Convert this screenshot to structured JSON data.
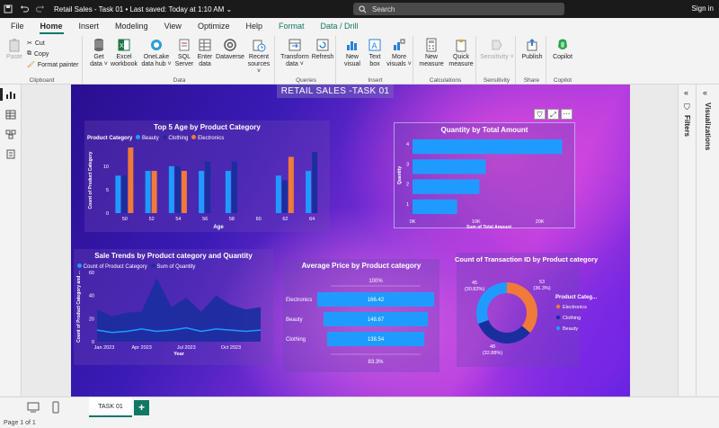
{
  "titlebar": {
    "title": "Retail Sales - Task 01",
    "saved": "Last saved: Today at 1:10 AM",
    "search_placeholder": "Search",
    "signin": "Sign in"
  },
  "menu": {
    "tabs": [
      "File",
      "Home",
      "Insert",
      "Modeling",
      "View",
      "Optimize",
      "Help",
      "Format",
      "Data / Drill"
    ]
  },
  "ribbon": {
    "clipboard": {
      "paste": "Paste",
      "cut": "Cut",
      "copy": "Copy",
      "format_painter": "Format painter",
      "label": "Clipboard"
    },
    "data": {
      "get_data": "Get data ˅",
      "excel": "Excel workbook",
      "onelake": "OneLake data hub ˅",
      "sql": "SQL Server",
      "enter": "Enter data",
      "dataverse": "Dataverse",
      "recent": "Recent sources ˅",
      "label": "Data"
    },
    "queries": {
      "transform": "Transform data ˅",
      "refresh": "Refresh",
      "label": "Queries"
    },
    "insert": {
      "new_visual": "New visual",
      "text_box": "Text box",
      "more_visuals": "More visuals ˅",
      "label": "Insert"
    },
    "calculations": {
      "new_measure": "New measure",
      "quick_measure": "Quick measure",
      "label": "Calculations"
    },
    "sensitivity": {
      "btn": "Sensitivity ˅",
      "label": "Sensitivity"
    },
    "share": {
      "publish": "Publish",
      "label": "Share"
    },
    "copilot": {
      "btn": "Copilot",
      "label": "Copilot"
    }
  },
  "report": {
    "title": "RETAIL SALES -TASK 01"
  },
  "panes": {
    "filters": "Filters",
    "visualizations": "Visualizations"
  },
  "pages": {
    "tab": "TASK 01",
    "add": "+"
  },
  "status": {
    "page": "Page 1 of 1"
  },
  "colors": {
    "beauty": "#1f9bff",
    "clothing": "#1a2e9e",
    "electronics": "#f07a3a",
    "accent": "#117865"
  },
  "chart_data": [
    {
      "type": "bar",
      "title": "Top 5 Age by Product Category",
      "legend_title": "Product Category",
      "xlabel": "Age",
      "ylabel": "Count of Product Category",
      "categories": [
        "50",
        "52",
        "54",
        "56",
        "58",
        "60",
        "62",
        "64"
      ],
      "ylim": [
        0,
        14
      ],
      "yticks": [
        "0",
        "5",
        "10"
      ],
      "series": [
        {
          "name": "Beauty",
          "values": [
            8,
            9,
            10,
            9,
            9,
            0,
            8,
            9
          ]
        },
        {
          "name": "Clothing",
          "values": [
            8,
            0,
            10,
            11,
            11,
            0,
            7,
            13
          ]
        },
        {
          "name": "Electronics",
          "values": [
            14,
            9,
            9,
            0,
            0,
            0,
            12,
            0
          ]
        }
      ],
      "extra": [
        {
          "cat_index": 0,
          "series": "Electronics"
        }
      ]
    },
    {
      "type": "bar",
      "orientation": "horizontal",
      "title": "Quantity by Total Amount",
      "xlabel": "Sum of Total Amount",
      "ylabel": "Quantity",
      "categories": [
        "4",
        "3",
        "2",
        "1"
      ],
      "values": [
        23500,
        11500,
        10500,
        7000
      ],
      "xlim": [
        0,
        24000
      ],
      "xticks": [
        "0K",
        "10K",
        "20K"
      ]
    },
    {
      "type": "area",
      "title": "Sale Trends by Product category and Quantity",
      "xlabel": "Year",
      "ylabel": "Count of Product Category and ...",
      "x": [
        "Jan 2023",
        "Feb 2023",
        "Mar 2023",
        "Apr 2023",
        "May 2023",
        "Jun 2023",
        "Jul 2023",
        "Aug 2023",
        "Sep 2023",
        "Oct 2023",
        "Nov 2023",
        "Dec 2023"
      ],
      "xticks": [
        "Jan 2023",
        "Apr 2023",
        "Jul 2023",
        "Oct 2023"
      ],
      "ylim": [
        0,
        60
      ],
      "yticks": [
        "0",
        "20",
        "40",
        "60"
      ],
      "series": [
        {
          "name": "Count of Product Category",
          "values": [
            10,
            8,
            9,
            11,
            9,
            10,
            12,
            9,
            11,
            10,
            9,
            10
          ]
        },
        {
          "name": "Sum of Quantity",
          "values": [
            28,
            22,
            25,
            26,
            55,
            30,
            38,
            26,
            40,
            32,
            28,
            30
          ]
        }
      ]
    },
    {
      "type": "funnel",
      "title": "Average Price by Product category",
      "top_label": "100%",
      "bottom_label": "83.3%",
      "categories": [
        "Electronics",
        "Beauty",
        "Clothing"
      ],
      "values": [
        166.42,
        148.67,
        138.54
      ],
      "value_labels": [
        "166.42",
        "148.67",
        "138.54"
      ]
    },
    {
      "type": "pie",
      "variant": "donut",
      "title": "Count of Transaction ID by Product category",
      "legend_title": "Product Categ...",
      "categories": [
        "Electronics",
        "Clothing",
        "Beauty"
      ],
      "values": [
        53,
        48,
        45
      ],
      "percents": [
        "(36.3%)",
        "(32.88%)",
        "(30.82%)"
      ],
      "value_labels": [
        "53",
        "48",
        "45"
      ]
    }
  ]
}
